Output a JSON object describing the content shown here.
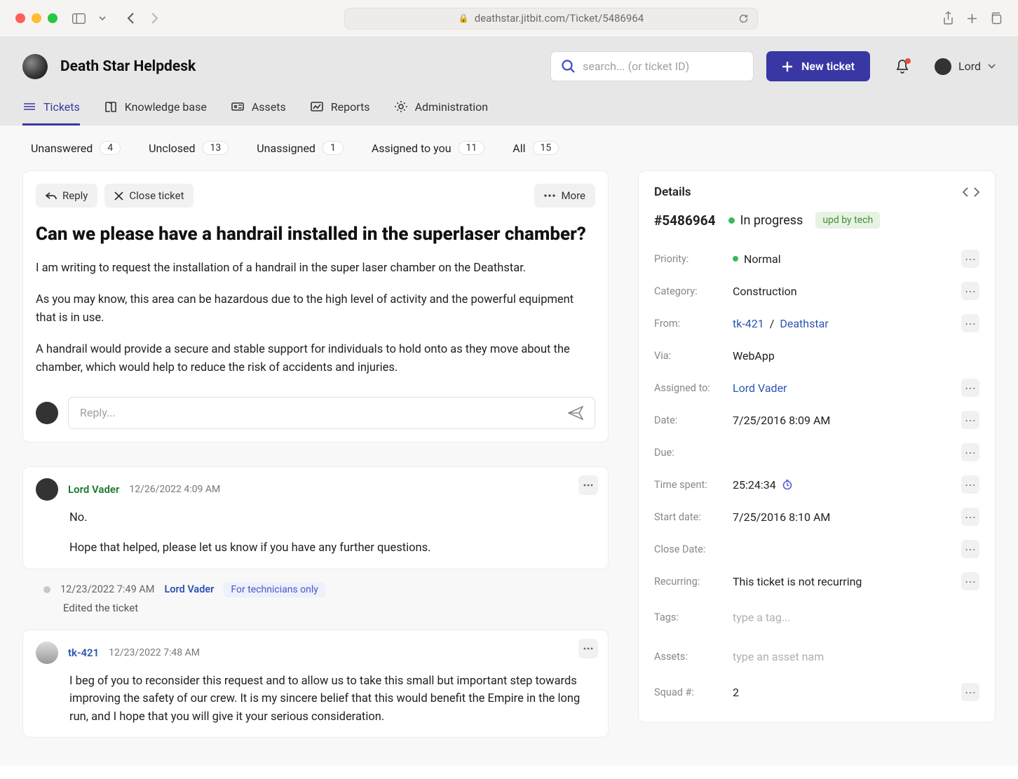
{
  "browser": {
    "url": "deathstar.jitbit.com/Ticket/5486964"
  },
  "header": {
    "app_title": "Death Star Helpdesk",
    "search_placeholder": "search... (or ticket ID)",
    "new_ticket": "New ticket",
    "user_name": "Lord"
  },
  "nav": {
    "tickets": "Tickets",
    "kb": "Knowledge base",
    "assets": "Assets",
    "reports": "Reports",
    "admin": "Administration"
  },
  "filters": {
    "unanswered": {
      "label": "Unanswered",
      "count": "4"
    },
    "unclosed": {
      "label": "Unclosed",
      "count": "13"
    },
    "unassigned": {
      "label": "Unassigned",
      "count": "1"
    },
    "assigned": {
      "label": "Assigned to you",
      "count": "11"
    },
    "all": {
      "label": "All",
      "count": "15"
    }
  },
  "ticket": {
    "actions": {
      "reply": "Reply",
      "close": "Close ticket",
      "more": "More"
    },
    "title": "Can we please have a handrail installed in the superlaser chamber?",
    "p1": "I am writing to request the installation of a handrail in the super laser chamber on the Deathstar.",
    "p2": "As you may know, this area can be hazardous due to the high level of activity and the powerful equipment that is in use.",
    "p3": "A handrail would provide a secure and stable support for individuals to hold onto as they move about the chamber, which would help to reduce the risk of accidents and injuries.",
    "reply_placeholder": "Reply..."
  },
  "comments": {
    "c1": {
      "author": "Lord Vader",
      "time": "12/26/2022 4:09 AM",
      "l1": "No.",
      "l2": "Hope that helped, please let us know if you have any further questions."
    },
    "audit": {
      "time": "12/23/2022 7:49 AM",
      "author": "Lord Vader",
      "tag": "For technicians only",
      "action": "Edited the ticket"
    },
    "c2": {
      "author": "tk-421",
      "time": "12/23/2022 7:48 AM",
      "body": "I beg of you to reconsider this request and to allow us to take this small but important step towards improving the safety of our crew. It is my sincere belief that this would benefit the Empire in the long run, and I hope that you will give it your serious consideration."
    }
  },
  "details": {
    "heading": "Details",
    "id": "#5486964",
    "status": "In progress",
    "upd_badge": "upd by tech",
    "priority_l": "Priority:",
    "priority_v": "Normal",
    "category_l": "Category:",
    "category_v": "Construction",
    "from_l": "From:",
    "from_user": "tk-421",
    "from_sep": " / ",
    "from_loc": "Deathstar",
    "via_l": "Via:",
    "via_v": "WebApp",
    "assigned_l": "Assigned to:",
    "assigned_v": "Lord Vader",
    "date_l": "Date:",
    "date_v": "7/25/2016 8:09 AM",
    "due_l": "Due:",
    "due_v": "",
    "time_l": "Time spent:",
    "time_v": "25:24:34",
    "start_l": "Start date:",
    "start_v": "7/25/2016 8:10 AM",
    "close_l": "Close Date:",
    "close_v": "",
    "recur_l": "Recurring:",
    "recur_v": "This ticket is not recurring",
    "tags_l": "Tags:",
    "tags_ph": "type a tag...",
    "assets_l": "Assets:",
    "assets_ph": "type an asset nam",
    "squad_l": "Squad #:",
    "squad_v": "2"
  }
}
